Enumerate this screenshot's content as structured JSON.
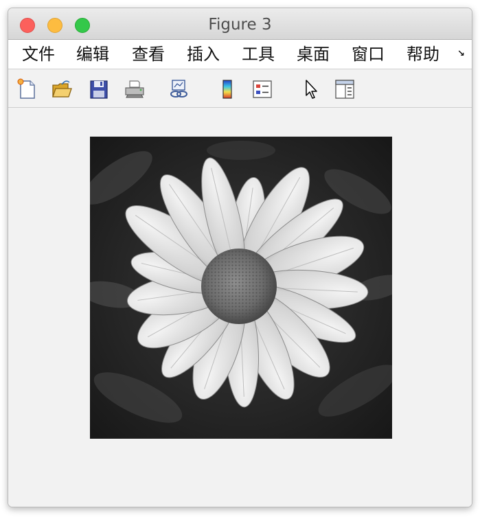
{
  "window": {
    "title": "Figure 3"
  },
  "menu": {
    "items": [
      "文件",
      "编辑",
      "查看",
      "插入",
      "工具",
      "桌面",
      "窗口",
      "帮助"
    ],
    "overflow_glyph": "↘"
  },
  "toolbar": {
    "tools": [
      {
        "name": "new-figure-icon"
      },
      {
        "name": "open-file-icon"
      },
      {
        "name": "save-figure-icon"
      },
      {
        "name": "print-figure-icon"
      },
      {
        "name": "link-plot-icon"
      },
      {
        "name": "insert-colorbar-icon"
      },
      {
        "name": "insert-legend-icon"
      },
      {
        "name": "edit-plot-cursor-icon"
      },
      {
        "name": "open-property-inspector-icon"
      }
    ]
  },
  "figure": {
    "image_subject": "grayscale daisy flower photo",
    "petal_count": 17
  }
}
